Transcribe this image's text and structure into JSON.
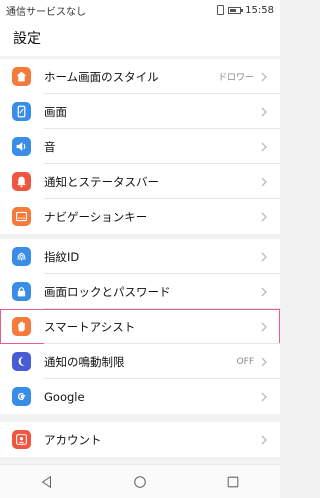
{
  "statusbar": {
    "carrier": "通信サービスなし",
    "time": "15:58"
  },
  "header": {
    "title": "設定"
  },
  "groups": [
    {
      "items": [
        {
          "label": "ホーム画面のスタイル",
          "value": "ドロワー",
          "icon": "home-icon",
          "color": "#f47b3c"
        },
        {
          "label": "画面",
          "value": "",
          "icon": "phone-display-icon",
          "color": "#3a8de6"
        },
        {
          "label": "音",
          "value": "",
          "icon": "speaker-icon",
          "color": "#3a8de6"
        },
        {
          "label": "通知とステータスバー",
          "value": "",
          "icon": "bell-icon",
          "color": "#f0553f"
        },
        {
          "label": "ナビゲーションキー",
          "value": "",
          "icon": "nav-keys-icon",
          "color": "#f47b3c"
        }
      ]
    },
    {
      "items": [
        {
          "label": "指紋ID",
          "value": "",
          "icon": "fingerprint-icon",
          "color": "#3a8de6"
        },
        {
          "label": "画面ロックとパスワード",
          "value": "",
          "icon": "lock-icon",
          "color": "#3a8de6"
        },
        {
          "label": "スマートアシスト",
          "value": "",
          "icon": "hand-icon",
          "color": "#f47b3c"
        },
        {
          "label": "通知の鳴動制限",
          "value": "OFF",
          "icon": "moon-icon",
          "color": "#4a5bd6"
        },
        {
          "label": "Google",
          "value": "",
          "icon": "google-icon",
          "color": "#3a8de6"
        }
      ]
    },
    {
      "items": [
        {
          "label": "アカウント",
          "value": "",
          "icon": "account-icon",
          "color": "#f0553f"
        }
      ]
    }
  ],
  "navbar": {
    "back": "back-icon",
    "home": "home-circle-icon",
    "recents": "recents-icon"
  }
}
